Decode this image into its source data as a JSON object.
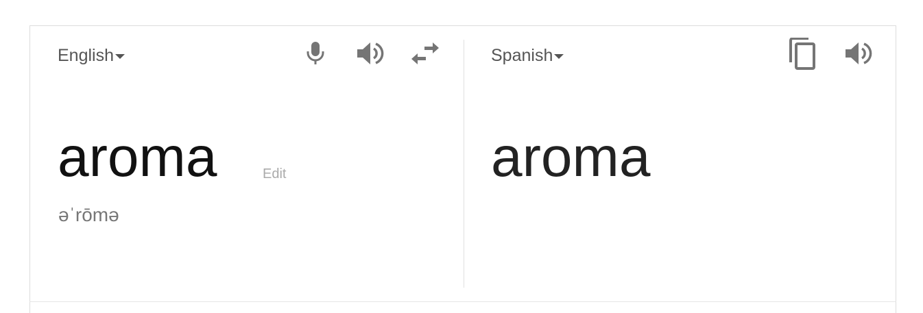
{
  "source": {
    "language": "English",
    "text": "aroma",
    "edit_label": "Edit",
    "phonetic": "əˈrōmə"
  },
  "target": {
    "language": "Spanish",
    "text": "aroma"
  },
  "icons": {
    "mic": "microphone-icon",
    "source_speaker": "speaker-icon",
    "swap": "swap-languages-icon",
    "copy": "copy-icon",
    "target_speaker": "speaker-icon"
  },
  "colors": {
    "icon": "#757575",
    "text": "#111111",
    "muted": "#aaaaaa",
    "border": "#dcdcdc"
  }
}
